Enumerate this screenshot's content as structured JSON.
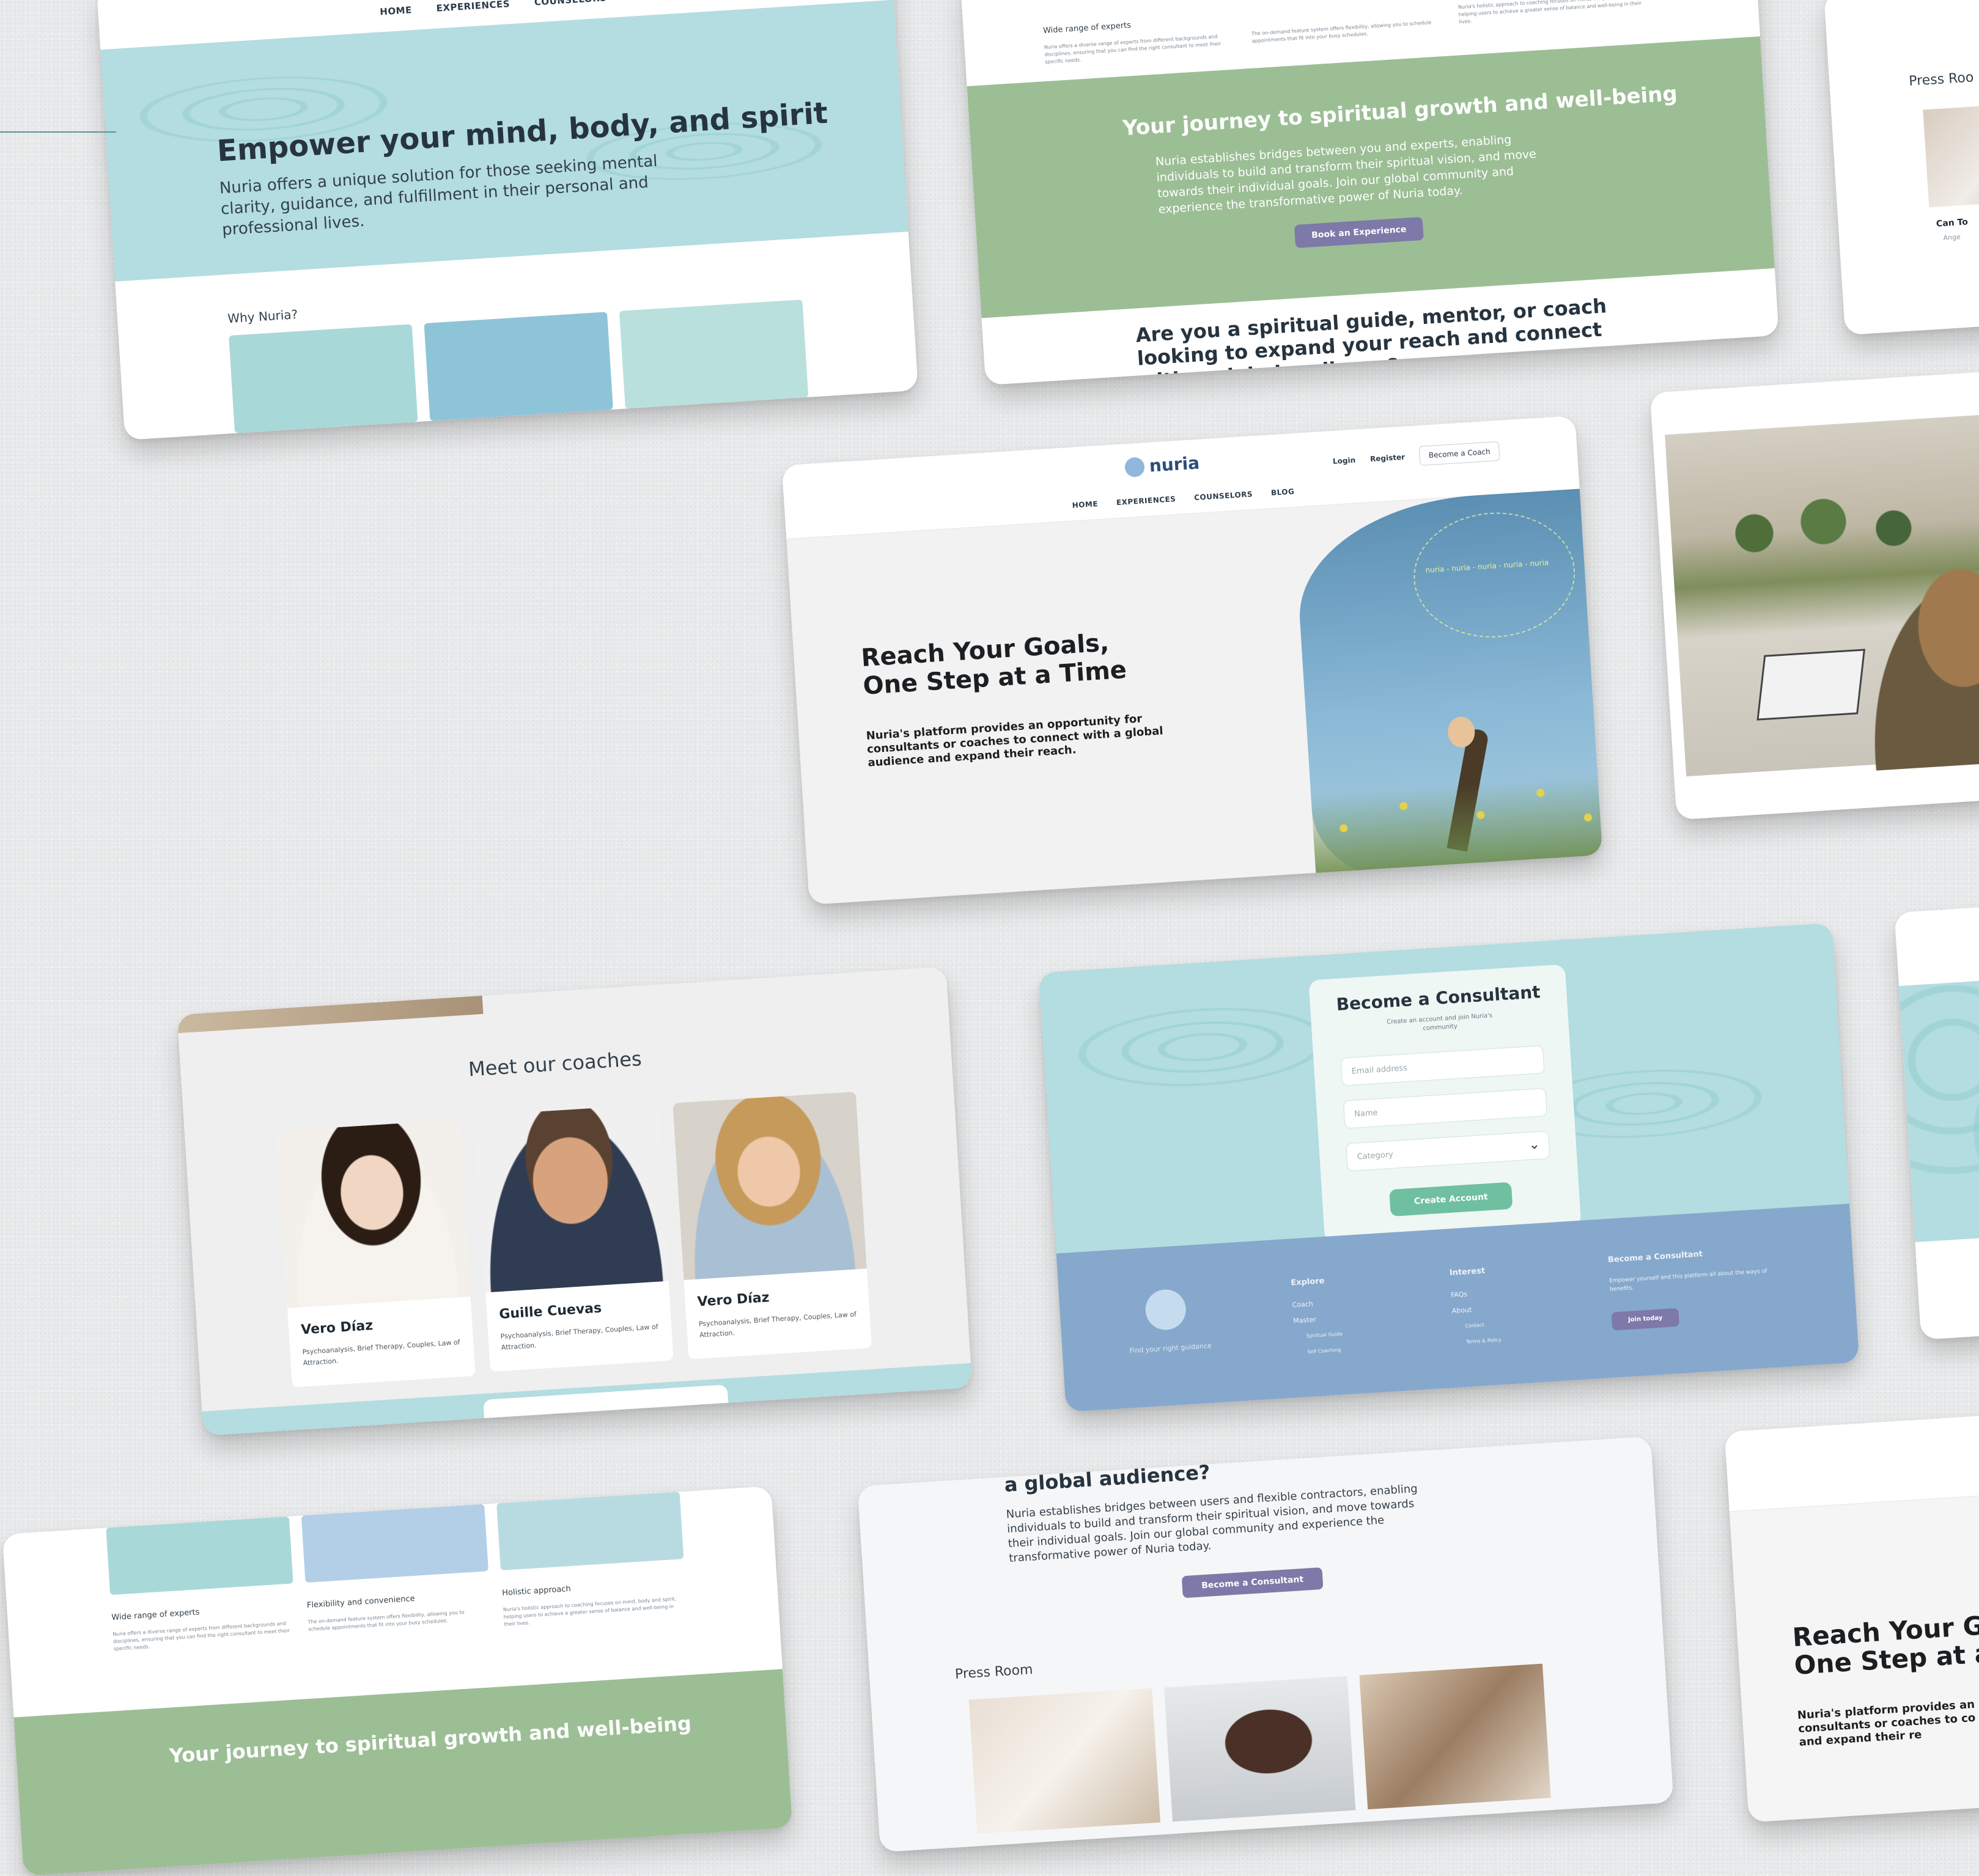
{
  "brand": {
    "logo_text": "nuria"
  },
  "colors": {
    "teal": "#b3dde0",
    "green": "#9cbe95",
    "purple": "#7d79a8",
    "footer_blue": "#86a8cc",
    "mint": "#6fc0a0",
    "text": "#27343f"
  },
  "nav": {
    "home": "HOME",
    "experiences": "EXPERIENCES",
    "counselors": "COUNSELORS",
    "blog": "BLOG",
    "login": "Login",
    "register": "Register",
    "become": "Become a Coach"
  },
  "hero1": {
    "title": "Empower your mind, body, and spirit",
    "body": "Nuria offers a unique solution for those seeking mental clarity, guidance, and fulfillment in their personal and professional lives.",
    "why": "Why Nuria?"
  },
  "features": {
    "f1_title": "Wide range of experts",
    "f1_body": "Nuria offers a diverse range of experts from different backgrounds and disciplines, ensuring that you can find the right consultant to meet their specific needs.",
    "f2_title": "Flexibility and convenience",
    "f2_body": "The on-demand feature system offers flexibility, allowing you to schedule appointments that fit into your busy schedules.",
    "f3_title": "Holistic approach",
    "f3_body": "Nuria's holistic approach to coaching focuses on mind, body and spirit, helping users to achieve a greater sense of balance and well-being in their lives."
  },
  "journey": {
    "title": "Your journey to spiritual growth and well-being",
    "body": "Nuria establishes bridges between you and experts, enabling individuals to build and transform their spiritual vision, and move towards their individual goals. Join our global community and experience the transformative power of Nuria today.",
    "button": "Book an Experience"
  },
  "guide": {
    "title": "Are you a spiritual guide, mentor, or coach looking to expand your reach and connect with a global audience?",
    "title_tail": "a global audience?",
    "body": "Nuria establishes bridges between users and flexible contractors, enabling individuals to build and transform their spiritual vision, and move towards their individual goals. Join our global community and experience the transformative power of Nuria today.",
    "button": "Become a Consultant"
  },
  "press": {
    "title": "Press Room",
    "title_short": "Press Roo",
    "card_title": "Can To",
    "card_author": "Ange"
  },
  "hero2": {
    "title_line1": "Reach Your Goals,",
    "title_line2": "One Step at a Time",
    "body": "Nuria's platform provides an opportunity for consultants or coaches to connect with a global audience and expand their reach.",
    "circle_text": "nuria - nuria - nuria - nuria - nuria",
    "title_line1_crop": "Reach Your Go",
    "title_line2_crop": "One Step at a",
    "body_crop": "Nuria's platform provides an consultants or coaches to co audience and expand their re"
  },
  "coaches": {
    "title": "Meet our coaches",
    "items": [
      {
        "name": "Vero Díaz",
        "desc": "Psychoanalysis, Brief Therapy, Couples, Law of Attraction."
      },
      {
        "name": "Guille Cuevas",
        "desc": "Psychoanalysis, Brief Therapy, Couples, Law of Attraction."
      },
      {
        "name": "Vero Díaz",
        "desc": "Psychoanalysis, Brief Therapy, Couples, Law of Attraction."
      }
    ]
  },
  "signup": {
    "title": "Become a Consultant",
    "subtitle": "Create an account and join Nuria's community",
    "email_placeholder": "Email address",
    "name_placeholder": "Name",
    "category_placeholder": "Category",
    "button": "Create Account"
  },
  "footer": {
    "tagline": "Find your right guidance",
    "col1_title": "Explore",
    "col1_items": [
      "Coach",
      "Master",
      "Spiritual Guide",
      "Self Coaching"
    ],
    "col2_title": "Interest",
    "col2_items": [
      "FAQs",
      "About",
      "Contact",
      "Terms & Policy"
    ],
    "col3_title": "Become a Consultant",
    "col3_body": "Empower yourself and this platform all about the ways of benefits.",
    "col3_button": "Join today"
  }
}
